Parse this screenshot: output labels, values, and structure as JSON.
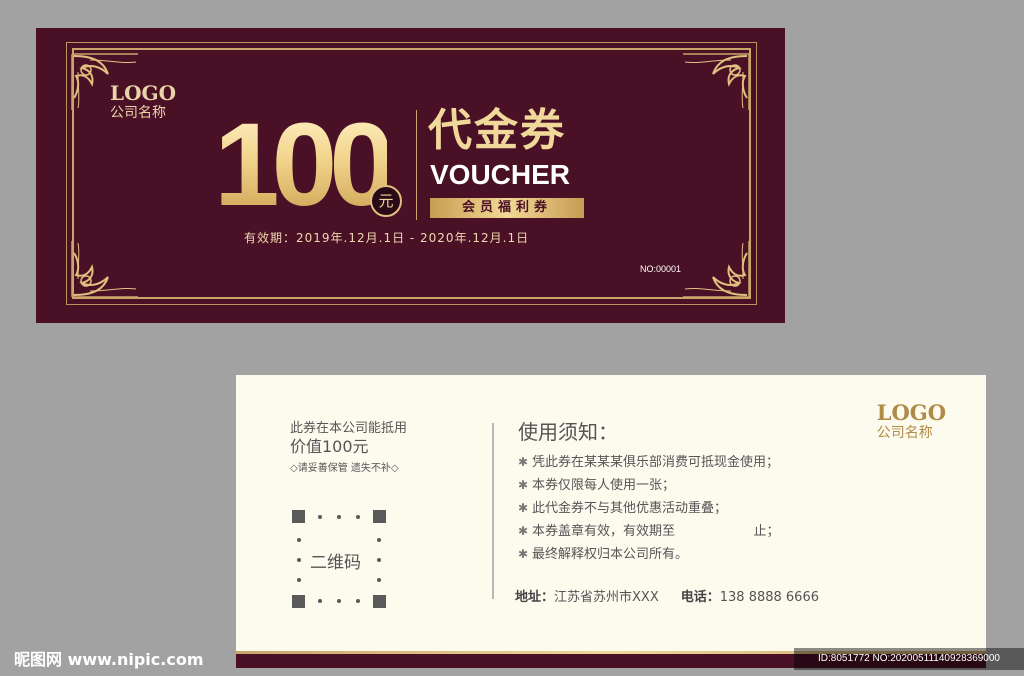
{
  "front": {
    "logo_text": "LOGO",
    "company_name": "公司名称",
    "amount": "100",
    "currency": "元",
    "title_cn": "代金券",
    "title_en": "VOUCHER",
    "member_tag": "会员福利券",
    "validity": "有效期：2019年.12月.1日 - 2020年.12月.1日",
    "serial": "NO:00001",
    "colors": {
      "background": "#4a1026",
      "gold": "#f0d79a",
      "border": "#c9a56a"
    },
    "corner_icon": "ornament-corner-icon"
  },
  "back": {
    "line1": "此券在本公司能抵用",
    "line2": "价值100元",
    "line3": "◇请妥善保管 遗失不补◇",
    "qr_label": "二维码",
    "logo_text": "LOGO",
    "company_name": "公司名称",
    "notice_title": "使用须知：",
    "notice_items": [
      "凭此券在某某某俱乐部消费可抵现金使用；",
      "本券仅限每人使用一张；",
      "此代金券不与其他优惠活动重叠；",
      "本券盖章有效，有效期至                   止；",
      "最终解释权归本公司所有。"
    ],
    "address_label": "地址：",
    "address_value": "江苏省苏州市XXX",
    "phone_label": "电话：",
    "phone_value": "138 8888 6666",
    "colors": {
      "background": "#fdfbee",
      "accent": "#b08a47"
    }
  },
  "watermark": {
    "left": "昵图网 www.nipic.com",
    "right": "ID:8051772 NO:20200511140928369000"
  }
}
